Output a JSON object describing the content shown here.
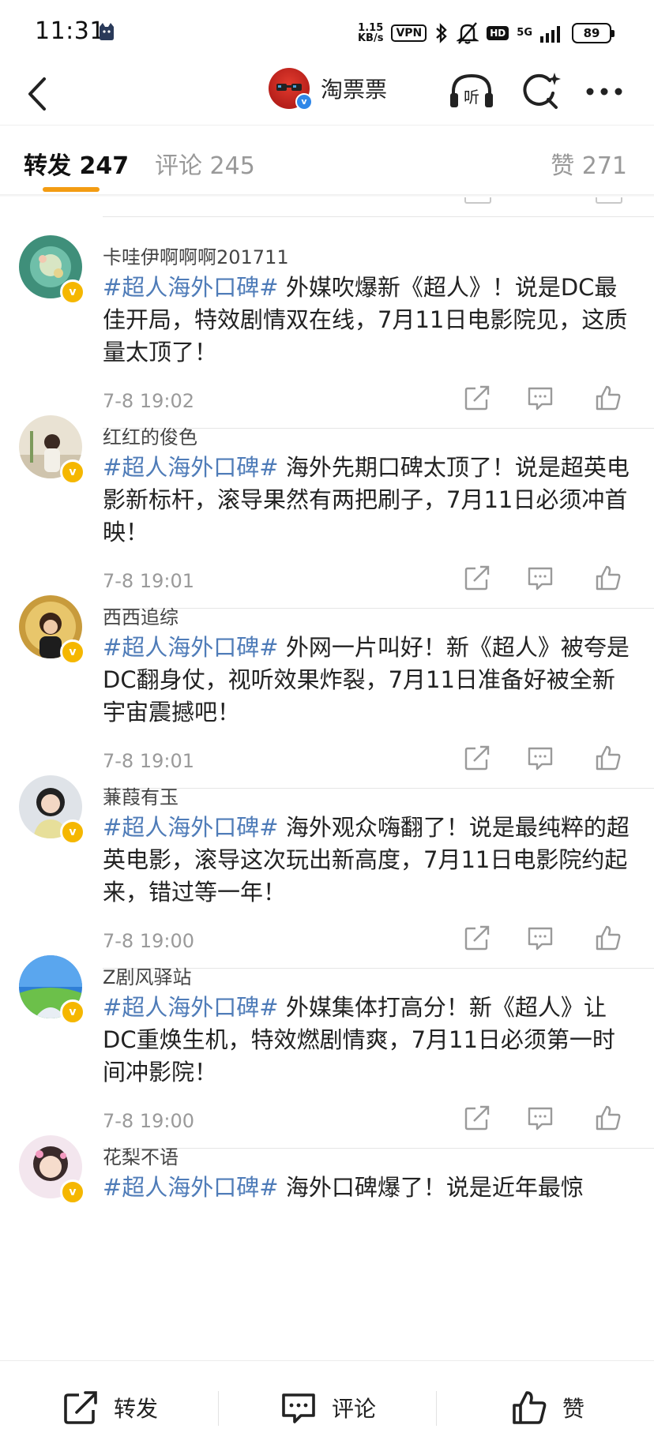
{
  "status_bar": {
    "time": "11:31",
    "net_speed_value": "1.15",
    "net_speed_unit": "KB/s",
    "vpn": "VPN",
    "hd": "HD",
    "network": "5G",
    "battery": "89"
  },
  "header": {
    "account_name": "淘票票",
    "icons": [
      "back-icon",
      "listen-icon",
      "search-sparkle-icon",
      "more-icon"
    ]
  },
  "tabs": {
    "repost": "转发 247",
    "comment": "评论 245",
    "like": "赞 271"
  },
  "reposts": [
    {
      "username": "卡哇伊啊啊啊201711",
      "hashtag": "#超人海外口碑#",
      "text": " 外媒吹爆新《超人》！说是DC最佳开局，特效剧情双在线，7月11日电影院见，这质量太顶了！",
      "time": "7-8 19:02"
    },
    {
      "username": "红红的俊色",
      "hashtag": "#超人海外口碑#",
      "text": " 海外先期口碑太顶了！说是超英电影新标杆，滚导果然有两把刷子，7月11日必须冲首映！",
      "time": "7-8 19:01"
    },
    {
      "username": "西西追综",
      "hashtag": "#超人海外口碑#",
      "text": " 外网一片叫好！新《超人》被夸是DC翻身仗，视听效果炸裂，7月11日准备好被全新宇宙震撼吧！",
      "time": "7-8 19:01"
    },
    {
      "username": "蒹葭有玉",
      "hashtag": "#超人海外口碑#",
      "text": " 海外观众嗨翻了！说是最纯粹的超英电影，滚导这次玩出新高度，7月11日电影院约起来，错过等一年！",
      "time": "7-8 19:00"
    },
    {
      "username": "Z剧风驿站",
      "hashtag": "#超人海外口碑#",
      "text": " 外媒集体打高分！新《超人》让DC重焕生机，特效燃剧情爽，7月11日必须第一时间冲影院！",
      "time": "7-8 19:00"
    },
    {
      "username": "花梨不语",
      "hashtag": "#超人海外口碑#",
      "text": " 海外口碑爆了！说是近年最惊",
      "time": ""
    }
  ],
  "bottom_bar": {
    "repost": "转发",
    "comment": "评论",
    "like": "赞"
  },
  "colors": {
    "hashtag": "#4f7cb8",
    "tab_underline": "#f39c12",
    "verified_badge": "#f5b700",
    "account_badge": "#2f87e8"
  }
}
